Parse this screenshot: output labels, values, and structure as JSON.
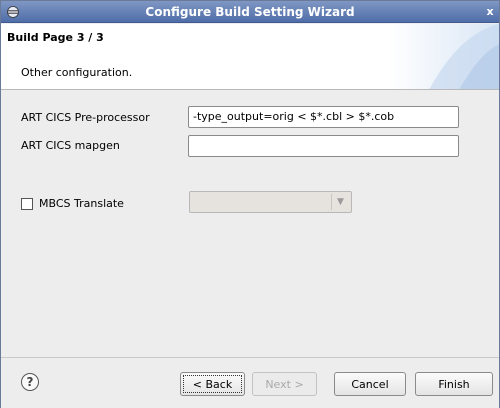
{
  "window": {
    "title": "Configure Build Setting Wizard",
    "close_glyph": "x"
  },
  "header": {
    "page_title": "Build Page 3 / 3",
    "description": "Other configuration."
  },
  "fields": {
    "preprocessor_label": "ART CICS Pre-processor",
    "preprocessor_value": "-type_output=orig < $*.cbl > $*.cob",
    "mapgen_label": "ART CICS mapgen",
    "mapgen_value": "",
    "mbcs_label": "MBCS Translate",
    "mbcs_checked": false,
    "mbcs_selected": ""
  },
  "buttons": {
    "help_glyph": "?",
    "back_label": "< Back",
    "next_label": "Next >",
    "cancel_label": "Cancel",
    "finish_label": "Finish"
  },
  "colors": {
    "titlebar": "#4f6da8",
    "header_bg": "#ffffff",
    "body_bg": "#ededed"
  }
}
